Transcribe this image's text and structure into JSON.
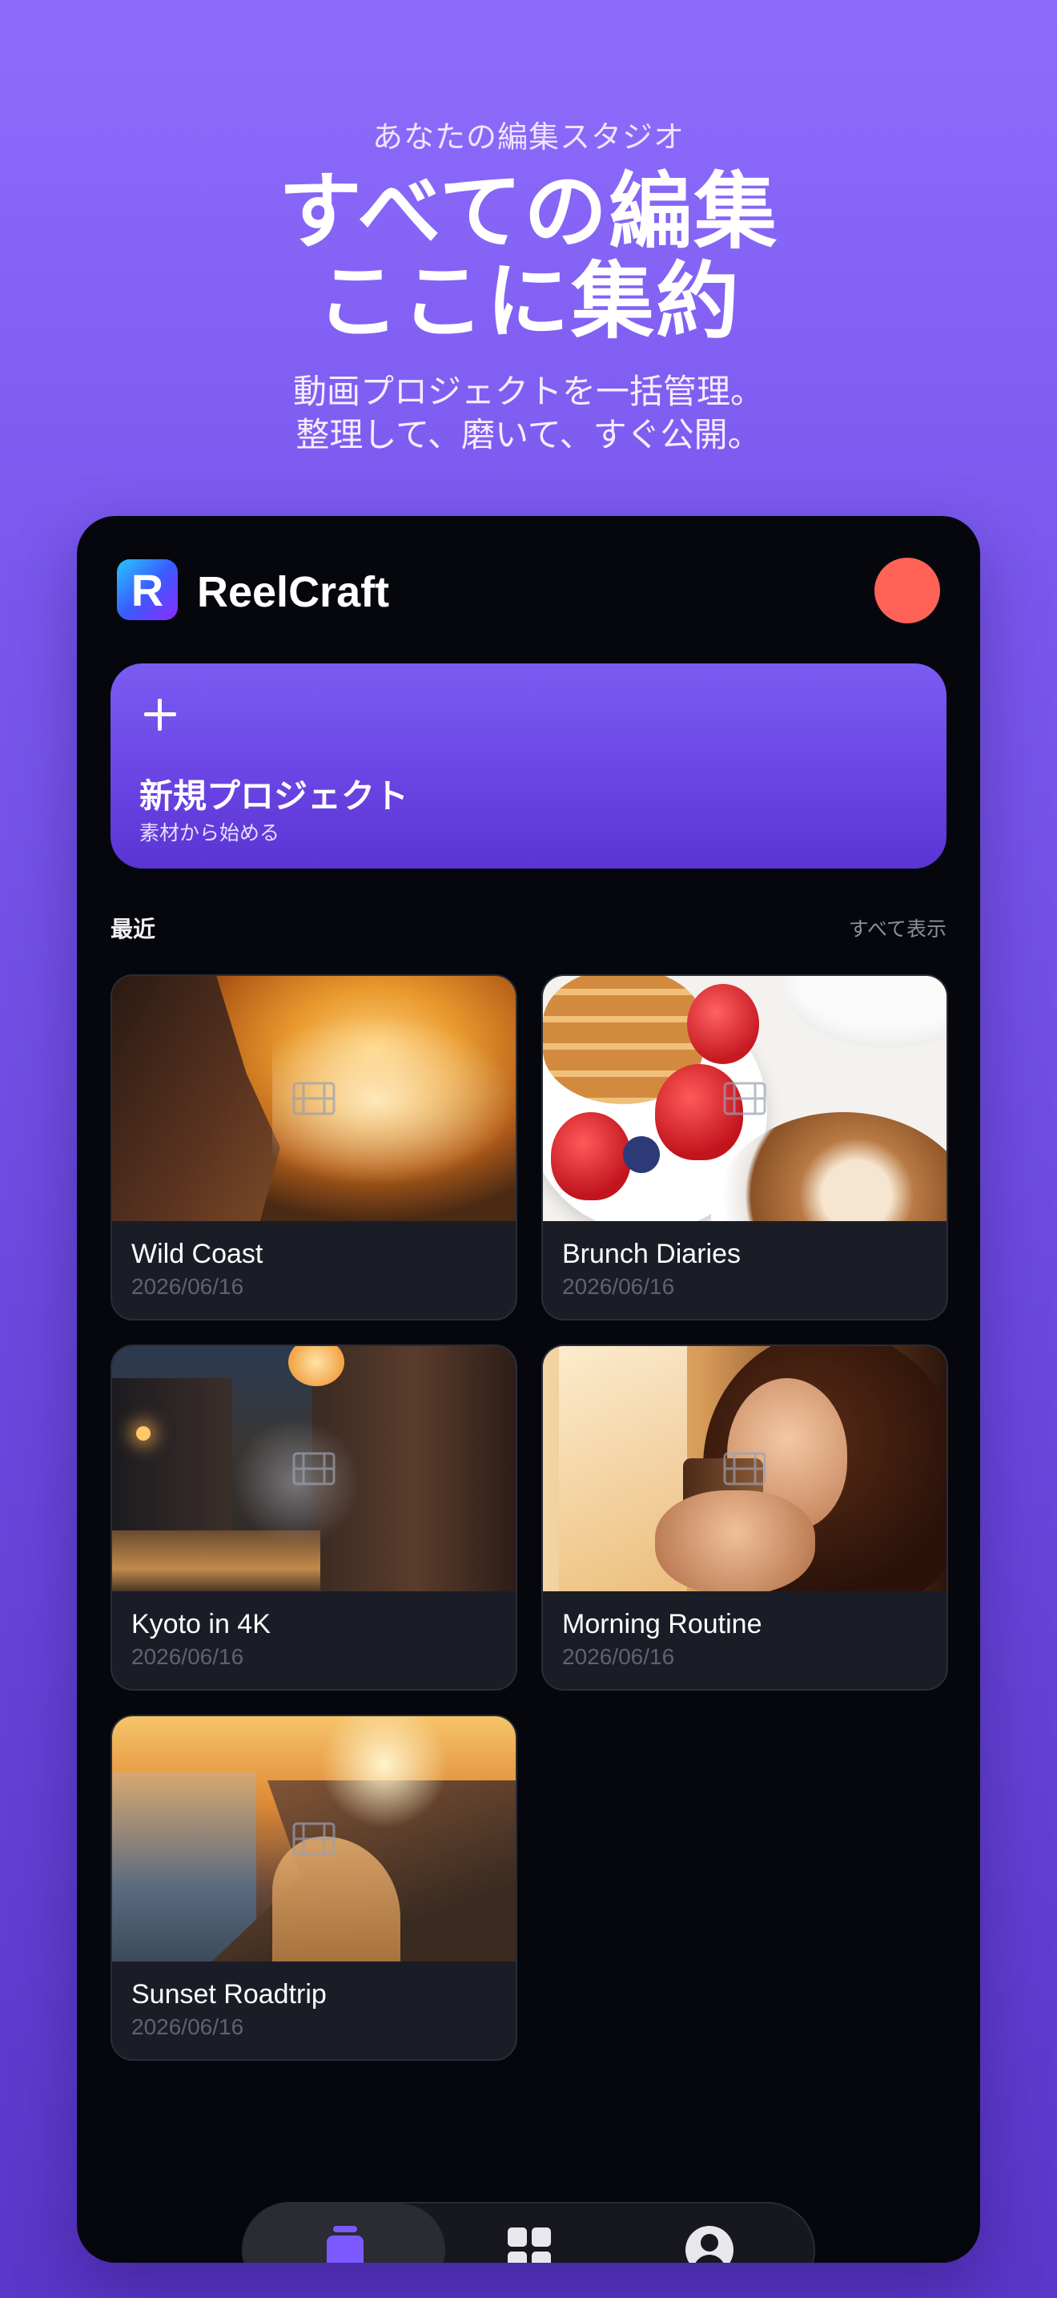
{
  "hero": {
    "eyebrow": "あなたの編集スタジオ",
    "headline_line1": "すべての編集",
    "headline_line2": "ここに集約",
    "subhead_line1": "動画プロジェクトを一括管理。",
    "subhead_line2": "整理して、磨いて、すぐ公開。"
  },
  "app": {
    "name": "ReelCraft",
    "logo_letter": "R",
    "avatar_color": "#ff6257",
    "accent": "#7c59ff"
  },
  "new_project": {
    "icon": "plus-icon",
    "title": "新規プロジェクト",
    "subtitle": "素材から始める"
  },
  "recent": {
    "label": "最近",
    "see_all": "すべて表示"
  },
  "projects": [
    {
      "title": "Wild Coast",
      "date": "2026/06/16",
      "icon": "film-icon"
    },
    {
      "title": "Brunch Diaries",
      "date": "2026/06/16",
      "icon": "film-icon"
    },
    {
      "title": "Kyoto in 4K",
      "date": "2026/06/16",
      "icon": "film-icon"
    },
    {
      "title": "Morning Routine",
      "date": "2026/06/16",
      "icon": "film-icon"
    },
    {
      "title": "Sunset Roadtrip",
      "date": "2026/06/16",
      "icon": "film-icon"
    }
  ],
  "tabbar": {
    "tabs": [
      {
        "icon": "projects-icon",
        "active": true
      },
      {
        "icon": "grid-icon",
        "active": false
      },
      {
        "icon": "profile-icon",
        "active": false
      }
    ]
  }
}
